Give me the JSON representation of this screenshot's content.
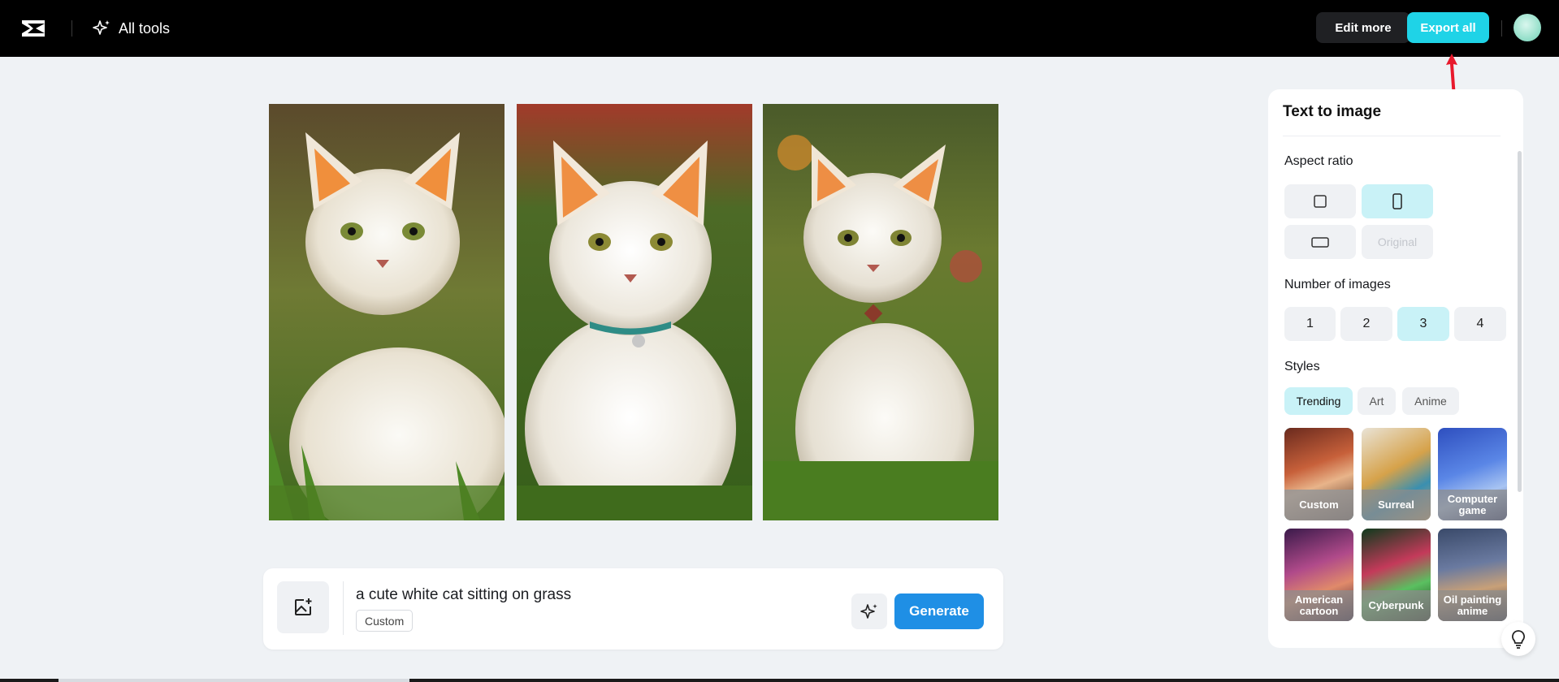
{
  "header": {
    "all_tools_label": "All tools",
    "edit_more_label": "Edit more",
    "export_all_label": "Export all"
  },
  "images": [
    {
      "alt": "a cute white cat sitting on grass"
    },
    {
      "alt": "a cute white cat sitting on grass"
    },
    {
      "alt": "a cute white cat sitting on grass"
    }
  ],
  "prompt": {
    "text": "a cute white cat sitting on grass",
    "style_chip": "Custom",
    "generate_label": "Generate"
  },
  "panel": {
    "title": "Text to image",
    "aspect_ratio": {
      "label": "Aspect ratio",
      "options": [
        "square",
        "portrait",
        "landscape",
        "Original"
      ],
      "selected": "portrait",
      "original_label": "Original"
    },
    "number_of_images": {
      "label": "Number of images",
      "options": [
        "1",
        "2",
        "3",
        "4"
      ],
      "selected": "3"
    },
    "styles": {
      "label": "Styles",
      "tabs": [
        "Trending",
        "Art",
        "Anime"
      ],
      "selected_tab": "Trending",
      "items": [
        {
          "label": "Custom",
          "selected": true
        },
        {
          "label": "Surreal",
          "selected": false
        },
        {
          "label": "Computer game",
          "selected": false
        },
        {
          "label": "American cartoon",
          "selected": false
        },
        {
          "label": "Cyberpunk",
          "selected": false
        },
        {
          "label": "Oil painting anime",
          "selected": false
        }
      ]
    }
  },
  "colors": {
    "accent": "#1fd3e7",
    "generate": "#1f8fe5",
    "selected_bg": "#c9f2f7"
  }
}
